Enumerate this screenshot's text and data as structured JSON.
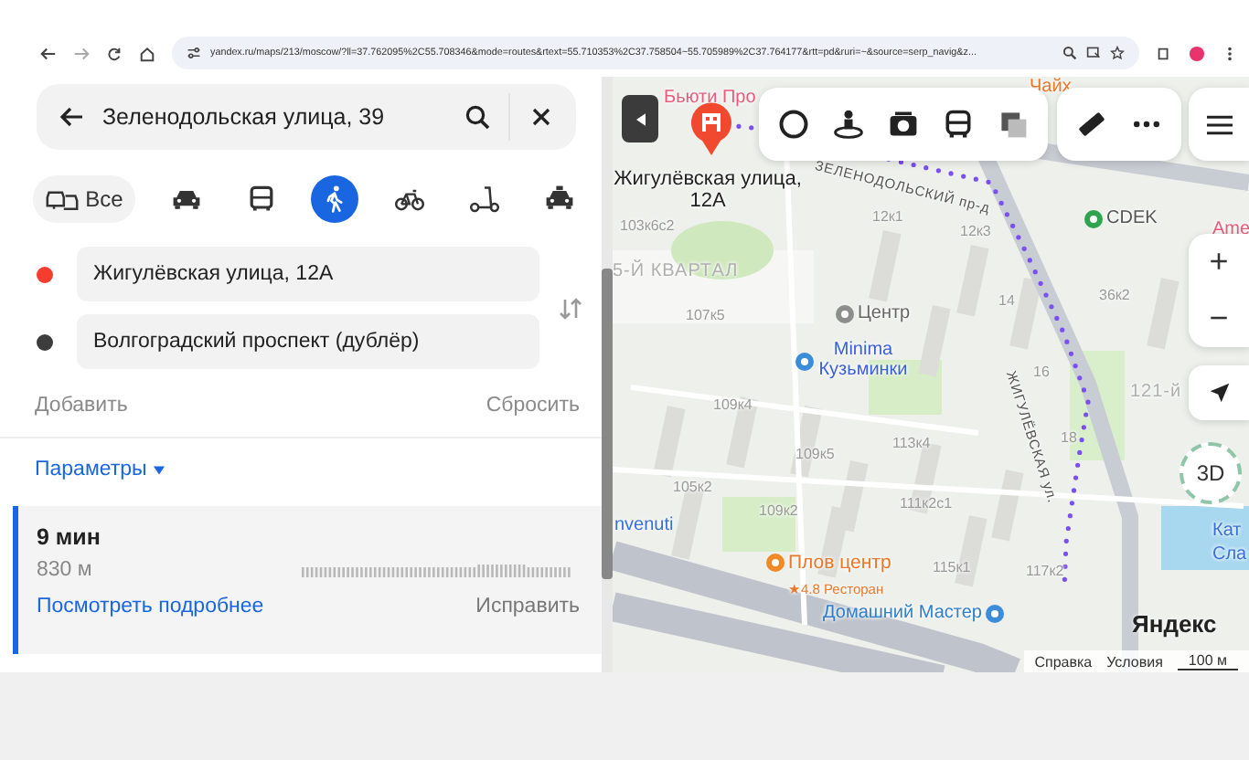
{
  "browser": {
    "url": "yandex.ru/maps/213/moscow/?ll=37.762095%2C55.708346&mode=routes&rtext=55.710353%2C37.758504~55.705989%2C37.764177&rtt=pd&ruri=~&source=serp_navig&z..."
  },
  "search": {
    "value": "Зеленодольская улица, 39"
  },
  "modes": [
    {
      "kind": "all",
      "label": "Все",
      "selected": false
    },
    {
      "kind": "car",
      "selected": false
    },
    {
      "kind": "bus",
      "selected": false
    },
    {
      "kind": "walk",
      "selected": true
    },
    {
      "kind": "bike",
      "selected": false
    },
    {
      "kind": "scooter",
      "selected": false
    },
    {
      "kind": "taxi",
      "selected": false
    }
  ],
  "route_points": [
    {
      "value": "Жигулёвская улица, 12А",
      "color": "#f43c2f"
    },
    {
      "value": "Волгоградский проспект (дублёр)",
      "color": "#3d3d3d"
    }
  ],
  "add_link": "Добавить",
  "reset_link": "Сбросить",
  "params_link": "Параметры",
  "routes": [
    {
      "time": "9 мин",
      "distance": "830 м",
      "details_link": "Посмотреть подробнее",
      "fix_link": "Исправить",
      "selected": true
    }
  ],
  "map": {
    "labels": [
      {
        "kind": "plain-pink",
        "text": "Бьюти Про"
      },
      {
        "kind": "plain-orange",
        "text": "Чайх"
      },
      {
        "kind": "marker",
        "text": "Жигулёвская улица, 12А"
      },
      {
        "kind": "building",
        "text": "103к6с2"
      },
      {
        "kind": "street",
        "text": "ЗЕЛЕНОДОЛЬСКИЙ пр-д"
      },
      {
        "kind": "building",
        "text": "12к1"
      },
      {
        "kind": "building",
        "text": "12к3"
      },
      {
        "kind": "office",
        "text": "CDEK"
      },
      {
        "kind": "plain-pink",
        "text": "Ame"
      },
      {
        "kind": "district",
        "text": "5-Й КВАРТАЛ"
      },
      {
        "kind": "place",
        "text": "Центр"
      },
      {
        "kind": "building",
        "text": "107к5"
      },
      {
        "kind": "building",
        "text": "14"
      },
      {
        "kind": "building",
        "text": "36к2"
      },
      {
        "kind": "hotel",
        "text": "Minima Кузьминки"
      },
      {
        "kind": "street",
        "text": "ЖИГУЛЁВСКАЯ ул."
      },
      {
        "kind": "building",
        "text": "16"
      },
      {
        "kind": "district",
        "text": "121-й"
      },
      {
        "kind": "building",
        "text": "109к4"
      },
      {
        "kind": "building",
        "text": "18"
      },
      {
        "kind": "building",
        "text": "113к4"
      },
      {
        "kind": "building",
        "text": "109к5"
      },
      {
        "kind": "building",
        "text": "105к2"
      },
      {
        "kind": "building",
        "text": "111к2с1"
      },
      {
        "kind": "building",
        "text": "109к2"
      },
      {
        "kind": "plain-blue",
        "text": "nvenuti"
      },
      {
        "kind": "restaurant",
        "text": "Плов центр"
      },
      {
        "kind": "rating",
        "text": "★4.8 Ресторан"
      },
      {
        "kind": "building",
        "text": "115к1"
      },
      {
        "kind": "building",
        "text": "117к2"
      },
      {
        "kind": "plain-blue",
        "text": "Кат"
      },
      {
        "kind": "plain-blue",
        "text": "Сла"
      },
      {
        "kind": "shop",
        "text": "Домашний Мастер"
      }
    ],
    "zoom_in": "+",
    "zoom_out": "−",
    "view_3d": "3D",
    "logo": "Яндекс",
    "footer_links": [
      "Справка",
      "Условия"
    ],
    "scale": "100 м"
  }
}
